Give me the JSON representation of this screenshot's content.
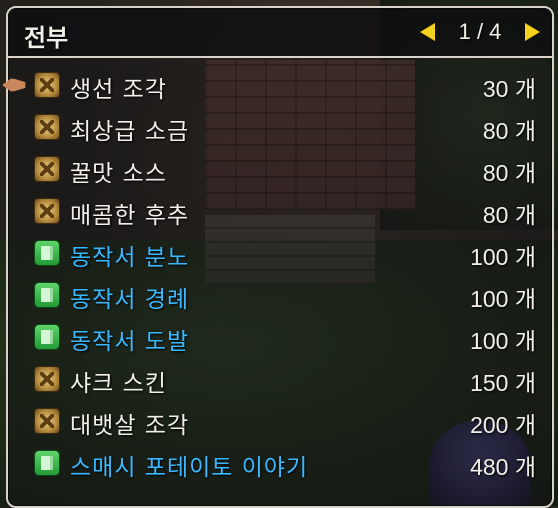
{
  "header": {
    "title": "전부",
    "page": "1 / 4"
  },
  "colors": {
    "accent_yellow": "#f4d21e",
    "skill_blue": "#3ab8ff",
    "text": "#f2efe8"
  },
  "items": [
    {
      "name": "생선 조각",
      "price": "30 개",
      "icon": "material-icon",
      "type": "material"
    },
    {
      "name": "최상급 소금",
      "price": "80 개",
      "icon": "material-icon",
      "type": "material"
    },
    {
      "name": "꿀맛 소스",
      "price": "80 개",
      "icon": "material-icon",
      "type": "material"
    },
    {
      "name": "매콤한 후추",
      "price": "80 개",
      "icon": "material-icon",
      "type": "material"
    },
    {
      "name": "동작서 분노",
      "price": "100 개",
      "icon": "book-icon",
      "type": "skill"
    },
    {
      "name": "동작서 경례",
      "price": "100 개",
      "icon": "book-icon",
      "type": "skill"
    },
    {
      "name": "동작서 도발",
      "price": "100 개",
      "icon": "book-icon",
      "type": "skill"
    },
    {
      "name": "샤크 스킨",
      "price": "150 개",
      "icon": "material-icon",
      "type": "material"
    },
    {
      "name": "대뱃살 조각",
      "price": "200 개",
      "icon": "material-icon",
      "type": "material"
    },
    {
      "name": "스매시 포테이토 이야기",
      "price": "480 개",
      "icon": "book-icon",
      "type": "skill"
    }
  ]
}
